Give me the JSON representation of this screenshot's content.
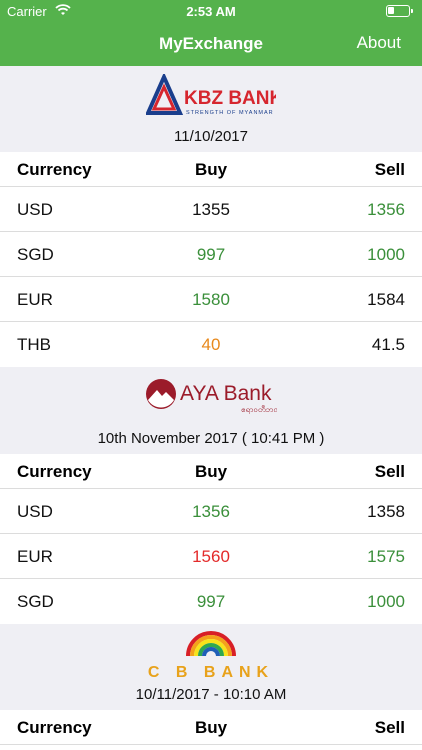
{
  "status": {
    "carrier": "Carrier",
    "time": "2:53 AM"
  },
  "nav": {
    "title": "MyExchange",
    "about": "About"
  },
  "colors": {
    "nav_bg": "#55b24c",
    "green": "#3a8f3a",
    "orange": "#e8891c",
    "red": "#e32b2b"
  },
  "banks": [
    {
      "logo_text": "KBZ BANK",
      "logo_tagline": "STRENGTH OF MYANMAR",
      "date": "11/10/2017",
      "headers": {
        "currency": "Currency",
        "buy": "Buy",
        "sell": "Sell"
      },
      "rows": [
        {
          "currency": "USD",
          "buy": "1355",
          "buy_color": "black",
          "sell": "1356",
          "sell_color": "green"
        },
        {
          "currency": "SGD",
          "buy": "997",
          "buy_color": "green",
          "sell": "1000",
          "sell_color": "green"
        },
        {
          "currency": "EUR",
          "buy": "1580",
          "buy_color": "green",
          "sell": "1584",
          "sell_color": "black"
        },
        {
          "currency": "THB",
          "buy": "40",
          "buy_color": "orange",
          "sell": "41.5",
          "sell_color": "black"
        }
      ]
    },
    {
      "logo_text": "AYA Bank",
      "logo_subtext": "ဧရာဝတီဘဏ်",
      "date": "10th November 2017 ( 10:41 PM  )",
      "headers": {
        "currency": "Currency",
        "buy": "Buy",
        "sell": "Sell"
      },
      "rows": [
        {
          "currency": "USD",
          "buy": "1356",
          "buy_color": "green",
          "sell": "1358",
          "sell_color": "black"
        },
        {
          "currency": "EUR",
          "buy": "1560",
          "buy_color": "red",
          "sell": "1575",
          "sell_color": "green"
        },
        {
          "currency": "SGD",
          "buy": "997",
          "buy_color": "green",
          "sell": "1000",
          "sell_color": "green"
        }
      ]
    },
    {
      "logo_text": "C B BANK",
      "date": "10/11/2017 - 10:10 AM",
      "headers": {
        "currency": "Currency",
        "buy": "Buy",
        "sell": "Sell"
      },
      "rows": []
    }
  ]
}
